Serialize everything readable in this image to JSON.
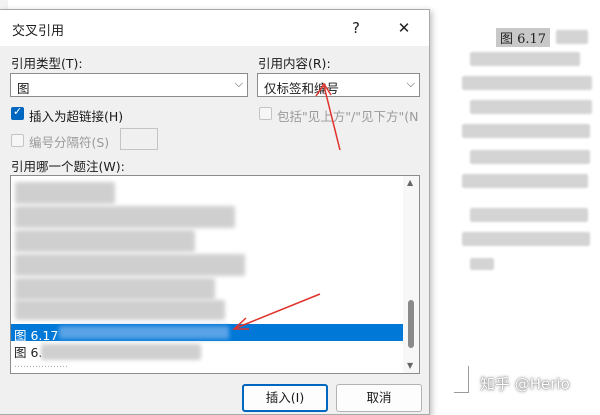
{
  "dialog": {
    "title": "交叉引用",
    "help_label": "?",
    "close_label": "✕",
    "ref_type_label": "引用类型(T):",
    "ref_type_value": "图",
    "ref_content_label": "引用内容(R):",
    "ref_content_value": "仅标签和编号",
    "insert_hyperlink_label": "插入为超链接(H)",
    "include_above_below_label": "包括\"见上方\"/\"见下方\"(N",
    "number_separator_label": "编号分隔符(S)",
    "which_caption_label": "引用哪一个题注(W):",
    "captions": {
      "selected": "图 6.17",
      "next": "图 6.",
      "partial_bottom": "………………"
    },
    "insert_button": "插入(I)",
    "cancel_button": "取消"
  },
  "document": {
    "caption": "图 6.17",
    "watermark": "知乎 @Herio"
  },
  "colors": {
    "accent": "#0067c0",
    "selection": "#0078d7",
    "arrow": "#e0322a"
  }
}
